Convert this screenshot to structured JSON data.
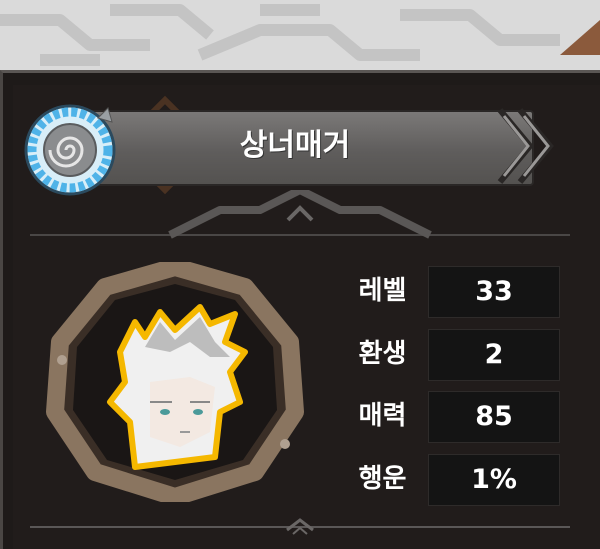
{
  "character": {
    "name": "상너매거"
  },
  "stats": [
    {
      "label": "레벨",
      "value": "33"
    },
    {
      "label": "환생",
      "value": "2"
    },
    {
      "label": "매력",
      "value": "85"
    },
    {
      "label": "행운",
      "value": "1%"
    }
  ],
  "colors": {
    "panel_bg": "#1e1a19",
    "banner": "#6a6867",
    "badge_blue": "#4fb3e8",
    "portrait_frame": "#8a7560",
    "stat_box": "#141414"
  },
  "icons": {
    "badge": "blue-spiral-emblem-icon",
    "banner_end": "double-chevron-icon",
    "portrait": "character-portrait"
  }
}
